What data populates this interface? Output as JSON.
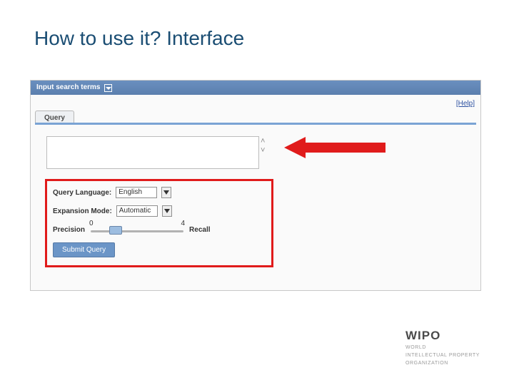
{
  "slide": {
    "title": "How to use it? Interface"
  },
  "panel": {
    "header": "Input search terms",
    "help": "[Help]"
  },
  "tabs": {
    "query": "Query"
  },
  "form": {
    "query_language_label": "Query Language:",
    "query_language_value": "English",
    "expansion_mode_label": "Expansion Mode:",
    "expansion_mode_value": "Automatic",
    "precision_label": "Precision",
    "recall_label": "Recall",
    "slider_min": "0",
    "slider_max": "4",
    "submit": "Submit Query"
  },
  "footer": {
    "brand": "WIPO",
    "line1": "WORLD",
    "line2": "INTELLECTUAL PROPERTY",
    "line3": "ORGANIZATION"
  }
}
